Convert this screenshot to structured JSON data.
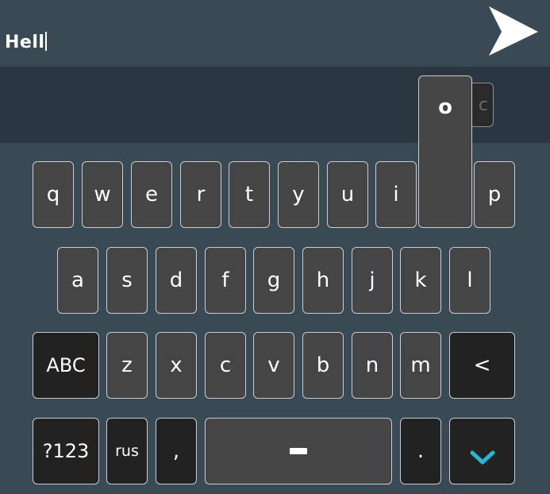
{
  "input": {
    "text": "Hell"
  },
  "popup": {
    "key_label": "o",
    "hidden_key_label": "c"
  },
  "keyboard": {
    "row1": [
      "q",
      "w",
      "e",
      "r",
      "t",
      "y",
      "u",
      "i",
      "o",
      "p"
    ],
    "row2": [
      "a",
      "s",
      "d",
      "f",
      "g",
      "h",
      "j",
      "k",
      "l"
    ],
    "row3_letters": [
      "z",
      "x",
      "c",
      "v",
      "b",
      "n",
      "m"
    ],
    "shift_label": "ABC",
    "backspace_label": "<",
    "symbols_label": "?123",
    "language_label": "rus",
    "comma_label": ",",
    "period_label": "."
  },
  "icons": {
    "send": "send-arrow-icon",
    "hide_keyboard": "chevron-down-icon"
  },
  "colors": {
    "background": "#3a4a55",
    "suggestion_bar": "#2a3740",
    "key_fill": "#454545",
    "dark_key_fill": "#222222",
    "accent": "#29b6d6"
  }
}
